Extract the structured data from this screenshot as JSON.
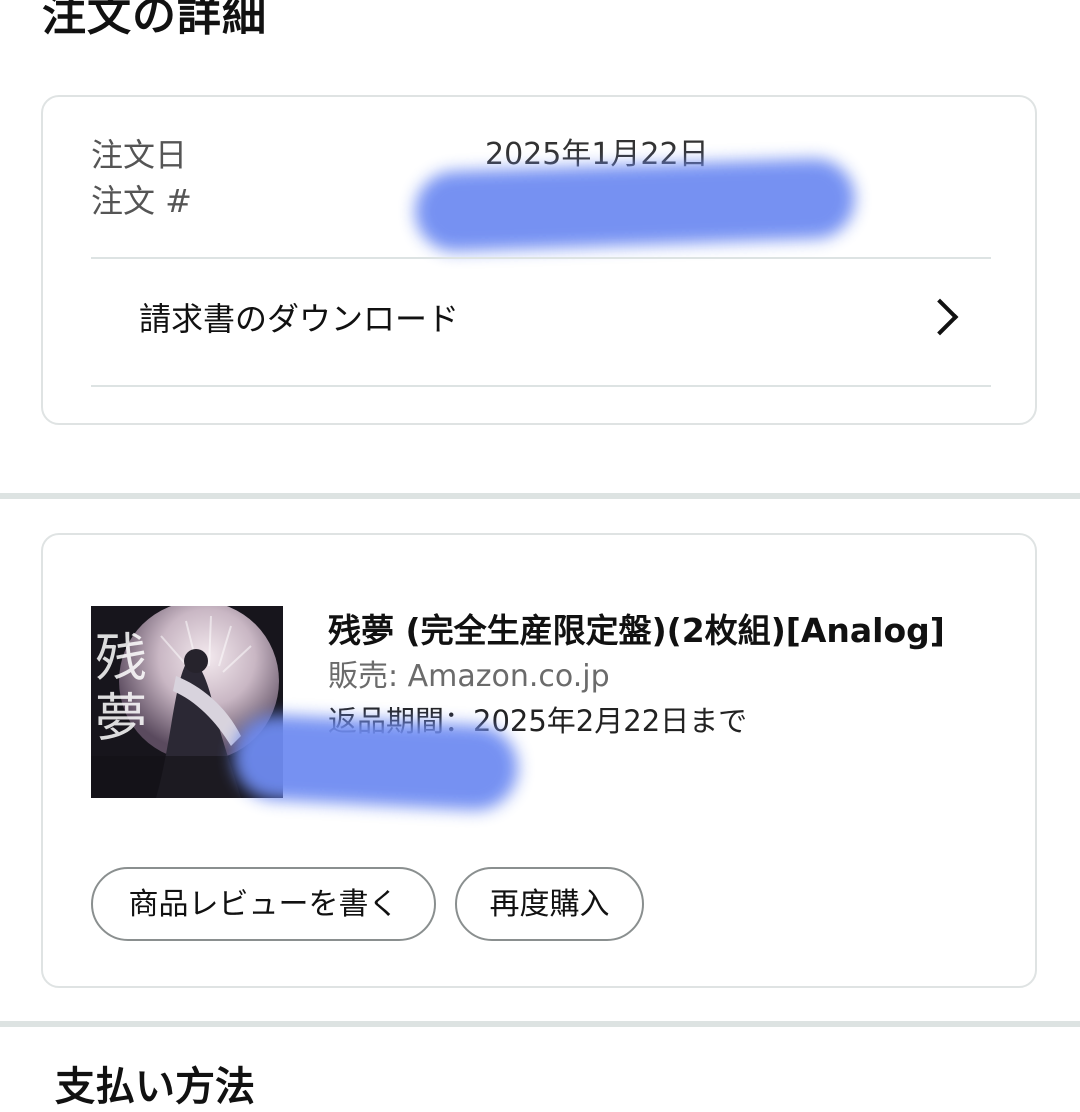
{
  "page": {
    "title": "注文の詳細"
  },
  "order": {
    "date_label": "注文日",
    "date_value": "2025年1月22日",
    "number_label": "注文 #",
    "invoice_link": "請求書のダウンロード"
  },
  "item": {
    "title": "残夢 (完全生産限定盤)(2枚組)[Analog]",
    "seller": "販売: Amazon.co.jp",
    "return_period": "返品期間：2025年2月22日まで",
    "cover_text": "残夢",
    "buttons": {
      "review": "商品レビューを書く",
      "rebuy": "再度購入"
    }
  },
  "next_section": {
    "title": "支払い方法"
  },
  "colors": {
    "redaction": "#6f8cf2",
    "border": "#dfe3e3",
    "separator": "#dde3e2"
  },
  "icons": {
    "invoice_chevron": "chevron-right-icon"
  }
}
